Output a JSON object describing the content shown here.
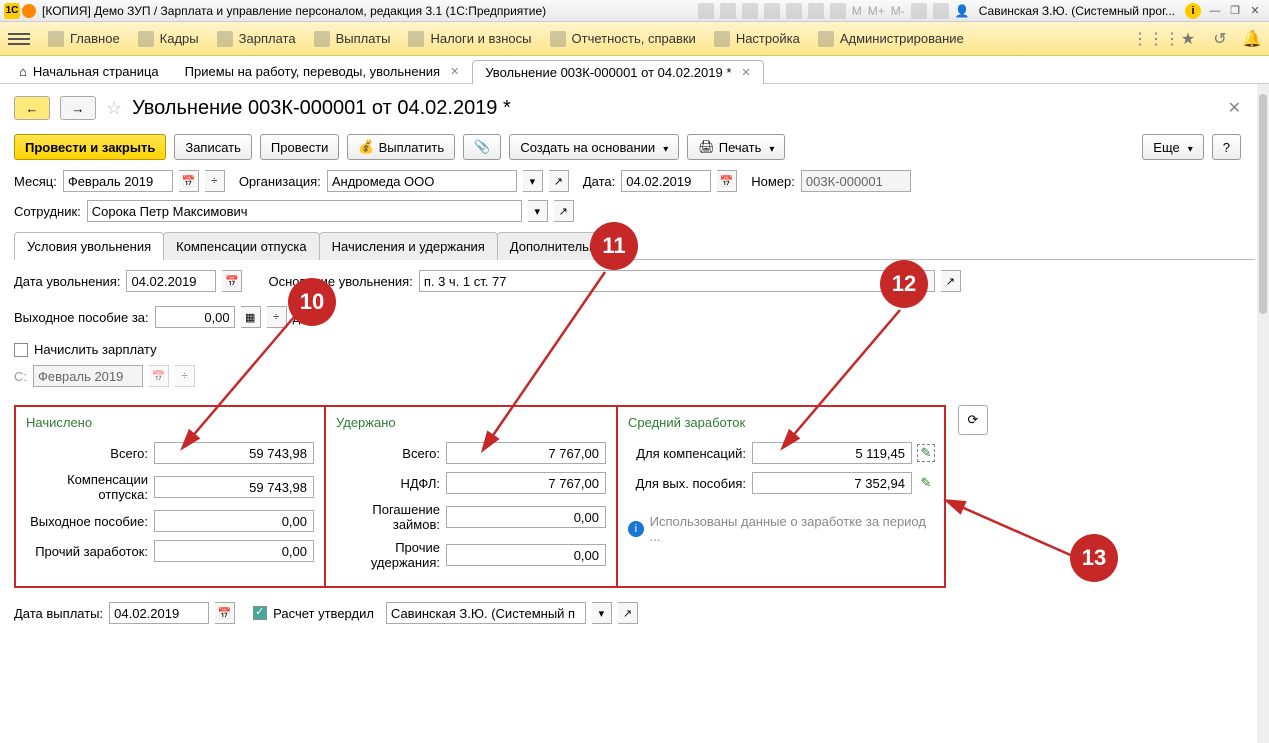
{
  "titlebar": {
    "app_title": "[КОПИЯ] Демо ЗУП / Зарплата и управление персоналом, редакция 3.1  (1С:Предприятие)",
    "user": "Савинская З.Ю. (Системный прог..."
  },
  "mainmenu": {
    "items": [
      "Главное",
      "Кадры",
      "Зарплата",
      "Выплаты",
      "Налоги и взносы",
      "Отчетность, справки",
      "Настройка",
      "Администрирование"
    ]
  },
  "tabs": {
    "items": [
      {
        "label": "Начальная страница",
        "closable": false
      },
      {
        "label": "Приемы на работу, переводы, увольнения",
        "closable": true
      },
      {
        "label": "Увольнение 003К-000001 от 04.02.2019 *",
        "closable": true,
        "active": true
      }
    ]
  },
  "page": {
    "title": "Увольнение 003К-000001 от 04.02.2019 *",
    "buttons": {
      "post_close": "Провести и закрыть",
      "save": "Записать",
      "post": "Провести",
      "pay": "Выплатить",
      "create_based": "Создать на основании",
      "print": "Печать",
      "more": "Еще",
      "help": "?"
    },
    "fields": {
      "month_lbl": "Месяц:",
      "month": "Февраль 2019",
      "org_lbl": "Организация:",
      "org": "Андромеда ООО",
      "date_lbl": "Дата:",
      "date": "04.02.2019",
      "num_lbl": "Номер:",
      "num": "003К-000001",
      "emp_lbl": "Сотрудник:",
      "emp": "Сорока Петр Максимович"
    },
    "subtabs": [
      "Условия увольнения",
      "Компенсации отпуска",
      "Начисления и удержания",
      "Дополнительно"
    ],
    "dismissal": {
      "date_lbl": "Дата увольнения:",
      "date": "04.02.2019",
      "reason_lbl": "Основание увольнения:",
      "reason": "п. 3 ч. 1 ст. 77",
      "sev_lbl": "Выходное пособие за:",
      "sev": "0,00",
      "sev_unit": "дн.",
      "calc_salary": "Начислить зарплату",
      "from_lbl": "С:",
      "from": "Февраль 2019"
    },
    "accrued": {
      "title": "Начислено",
      "total_lbl": "Всего:",
      "total": "59 743,98",
      "vac_lbl": "Компенсации отпуска:",
      "vac": "59 743,98",
      "sev_lbl": "Выходное пособие:",
      "sev": "0,00",
      "other_lbl": "Прочий заработок:",
      "other": "0,00"
    },
    "withheld": {
      "title": "Удержано",
      "total_lbl": "Всего:",
      "total": "7 767,00",
      "ndfl_lbl": "НДФЛ:",
      "ndfl": "7 767,00",
      "loan_lbl": "Погашение займов:",
      "loan": "0,00",
      "other_lbl": "Прочие удержания:",
      "other": "0,00"
    },
    "avg": {
      "title": "Средний заработок",
      "comp_lbl": "Для компенсаций:",
      "comp": "5 119,45",
      "sev_lbl": "Для вых. пособия:",
      "sev": "7 352,94"
    },
    "info": "Использованы данные о заработке за период ...",
    "paydate_lbl": "Дата выплаты:",
    "paydate": "04.02.2019",
    "approved": "Расчет утвердил",
    "approver": "Савинская З.Ю. (Системный п"
  },
  "callouts": {
    "c10": "10",
    "c11": "11",
    "c12": "12",
    "c13": "13"
  }
}
